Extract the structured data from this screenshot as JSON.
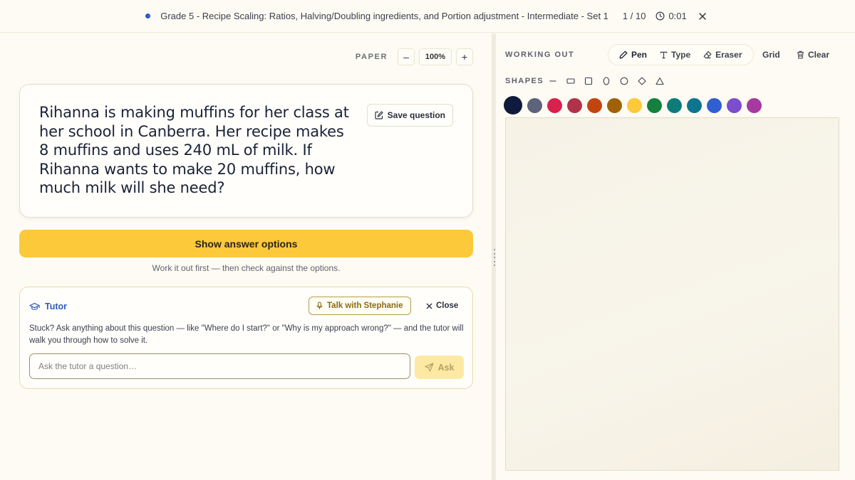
{
  "topbar": {
    "title": "Grade 5 - Recipe Scaling: Ratios, Halving/Doubling ingredients, and Portion adjustment - Intermediate - Set 1",
    "progress": "1 / 10",
    "timer": "0:01",
    "dot_color": "#2e5bbf"
  },
  "paper": {
    "label": "PAPER",
    "zoom": "100%",
    "zoom_out": "–",
    "zoom_in": "+"
  },
  "question": {
    "text": "Rihanna is making muffins for her class at her school in Canberra. Her recipe makes 8 muffins and uses 240 mL of milk. If Rihanna wants to make 20 muffins, how much milk will she need?",
    "save_label": "Save question"
  },
  "answers": {
    "show_label": "Show answer options",
    "hint": "Work it out first — then check against the options.",
    "button_color": "#fcc93a"
  },
  "tutor": {
    "title": "Tutor",
    "talk_label": "Talk with Stephanie",
    "close_label": "Close",
    "description": "Stuck? Ask anything about this question — like \"Where do I start?\" or \"Why is my approach wrong?\" — and the tutor will walk you through how to solve it.",
    "input_placeholder": "Ask the tutor a question…",
    "ask_label": "Ask"
  },
  "working": {
    "label": "WORKING OUT",
    "tools": [
      {
        "label": "Pen",
        "icon": "pen-icon",
        "active": true
      },
      {
        "label": "Type",
        "icon": "type-icon"
      },
      {
        "label": "Eraser",
        "icon": "eraser-icon"
      }
    ],
    "grid_label": "Grid",
    "clear_label": "Clear",
    "shapes_label": "SHAPES",
    "shapes": [
      "line",
      "rectangle",
      "square",
      "ellipse",
      "circle",
      "diamond",
      "triangle"
    ],
    "colors": [
      "#101a3d",
      "#5c637a",
      "#d9214e",
      "#b0334a",
      "#c24510",
      "#a16207",
      "#fcc93a",
      "#15803d",
      "#0f7c7a",
      "#0e7490",
      "#2f5fd0",
      "#7c4dcc",
      "#a63aa0"
    ],
    "selected_color": "#101a3d"
  }
}
